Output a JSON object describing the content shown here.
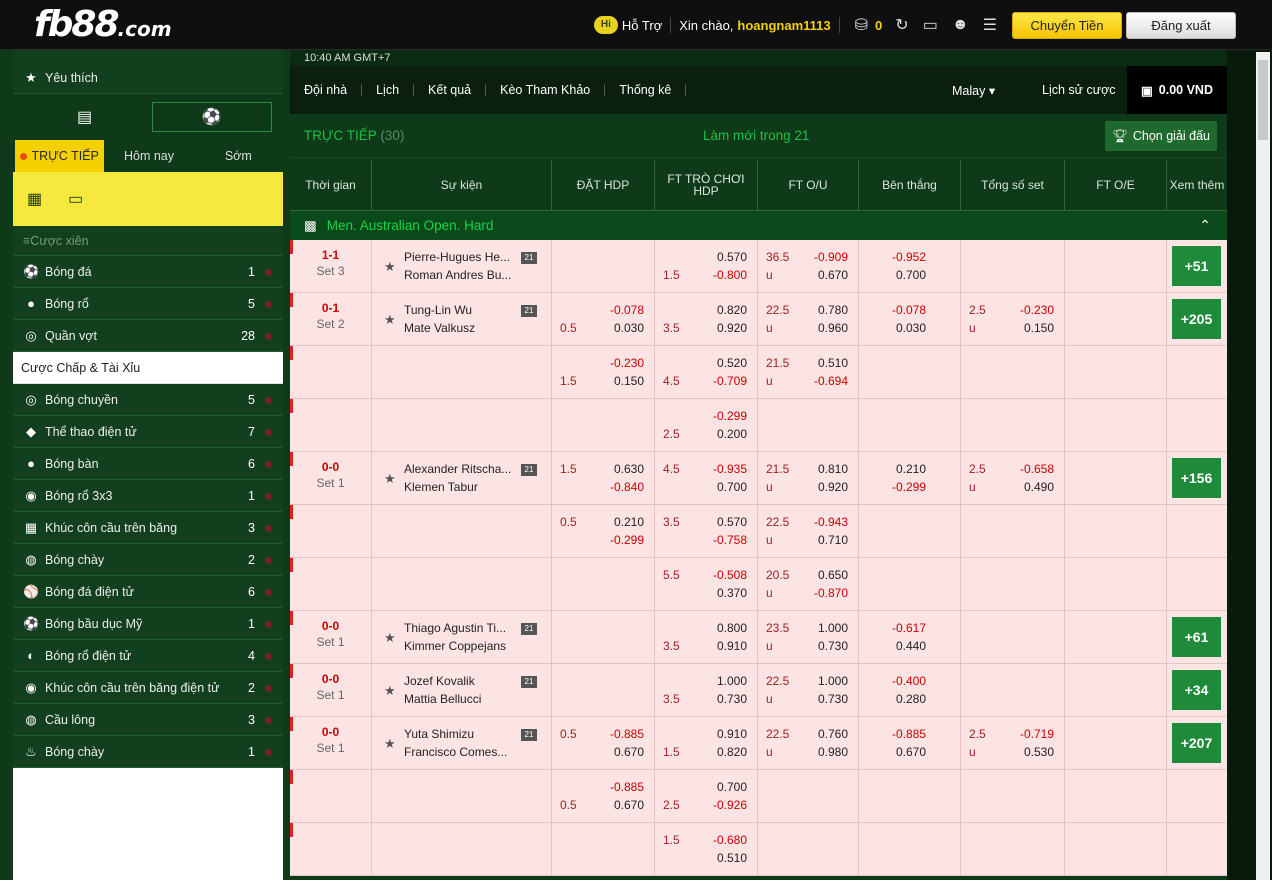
{
  "header": {
    "logo_main": "fb88",
    "logo_suffix": ".com",
    "hi": "Hi",
    "support": "Hỗ Trợ",
    "greeting": "Xin chào,",
    "username": "hoangnam1113",
    "balance_count": "0",
    "deposit": "Chuyển Tiền",
    "logout": "Đăng xuất"
  },
  "sidebar": {
    "favorites": "Yêu thích",
    "status_tabs": [
      "TRỰC TIẾP",
      "Hôm nay",
      "Sớm"
    ],
    "parlay": "Cược xiên",
    "sports": [
      {
        "name": "Bóng đá",
        "count": "1"
      },
      {
        "name": "Bóng rổ",
        "count": "5"
      },
      {
        "name": "Quần vợt",
        "count": "28"
      }
    ],
    "selected_market": "Cược Chấp & Tài Xỉu",
    "sports2": [
      {
        "name": "Bóng chuyền",
        "count": "5"
      },
      {
        "name": "Thể thao điện tử",
        "count": "7"
      },
      {
        "name": "Bóng bàn",
        "count": "6"
      },
      {
        "name": "Bóng rổ 3x3",
        "count": "1"
      },
      {
        "name": "Khúc côn cầu trên băng",
        "count": "3"
      },
      {
        "name": "Bóng chày",
        "count": "2"
      },
      {
        "name": "Bóng đá điện tử",
        "count": "6"
      },
      {
        "name": "Bóng bầu dục Mỹ",
        "count": "1"
      },
      {
        "name": "Bóng rổ điện tử",
        "count": "4"
      },
      {
        "name": "Khúc côn cầu trên băng điện tử",
        "count": "2"
      },
      {
        "name": "Cầu lông",
        "count": "3"
      },
      {
        "name": "Bóng chày",
        "count": "1"
      }
    ]
  },
  "main": {
    "clock": "10:40 AM GMT+7",
    "nav": [
      "Đội nhà",
      "Lịch",
      "Kết quả",
      "Kèo Tham Khảo",
      "Thống kê"
    ],
    "odds_type": "Malay",
    "history": "Lịch sử cược",
    "wallet": "0.00 VND",
    "live_label": "TRỰC TIẾP",
    "live_count": "(30)",
    "refresh": "Làm mới trong 21",
    "pick_league": "Chọn giải đấu",
    "columns": [
      "Thời gian",
      "Sự kiện",
      "ĐẶT HDP",
      "FT TRÒ CHƠI HDP",
      "FT O/U",
      "Bên thắng",
      "Tổng số set",
      "FT O/E",
      "Xem thêm"
    ],
    "league": "Men. Australian Open. Hard",
    "rows": [
      {
        "score": "1-1",
        "set": "Set 3",
        "t1": "Pierre-Hugues He...",
        "t2": "Roman Andres Bu...",
        "h": [
          "",
          "",
          "",
          "",
          ""
        ],
        "g": [
          "",
          "0.570",
          "1.5",
          "-0.800"
        ],
        "ou": [
          "36.5",
          "-0.909",
          "u",
          "0.670"
        ],
        "w": [
          "-0.952",
          "0.700"
        ],
        "s": [
          "",
          "",
          "",
          ""
        ],
        "more": "+51"
      },
      {
        "score": "0-1",
        "set": "Set 2",
        "t1": "Tung-Lin Wu",
        "t2": "Mate Valkusz",
        "h": [
          "",
          "-0.078",
          "0.5",
          "0.030"
        ],
        "g": [
          "",
          "0.820",
          "3.5",
          "0.920"
        ],
        "ou": [
          "22.5",
          "0.780",
          "u",
          "0.960"
        ],
        "w": [
          "-0.078",
          "0.030"
        ],
        "s": [
          "2.5",
          "-0.230",
          "u",
          "0.150"
        ],
        "more": "+205"
      },
      {
        "score": "",
        "set": "",
        "t1": "",
        "t2": "",
        "h": [
          "",
          "-0.230",
          "1.5",
          "0.150"
        ],
        "g": [
          "",
          "0.520",
          "4.5",
          "-0.709"
        ],
        "ou": [
          "21.5",
          "0.510",
          "u",
          "-0.694"
        ],
        "w": [
          "",
          ""
        ],
        "s": [
          "",
          "",
          "",
          ""
        ],
        "more": ""
      },
      {
        "score": "",
        "set": "",
        "t1": "",
        "t2": "",
        "h": [
          "",
          "",
          "",
          ""
        ],
        "g": [
          "",
          "-0.299",
          "2.5",
          "0.200"
        ],
        "ou": [
          "",
          "",
          "",
          ""
        ],
        "w": [
          "",
          ""
        ],
        "s": [
          "",
          "",
          "",
          ""
        ],
        "more": ""
      },
      {
        "score": "0-0",
        "set": "Set 1",
        "t1": "Alexander Ritscha...",
        "t2": "Klemen Tabur",
        "h": [
          "1.5",
          "0.630",
          "",
          "-0.840"
        ],
        "g": [
          "4.5",
          "-0.935",
          "",
          "0.700"
        ],
        "ou": [
          "21.5",
          "0.810",
          "u",
          "0.920"
        ],
        "w": [
          "0.210",
          "-0.299"
        ],
        "s": [
          "2.5",
          "-0.658",
          "u",
          "0.490"
        ],
        "more": "+156"
      },
      {
        "score": "",
        "set": "",
        "t1": "",
        "t2": "",
        "h": [
          "0.5",
          "0.210",
          "",
          "-0.299"
        ],
        "g": [
          "3.5",
          "0.570",
          "",
          "-0.758"
        ],
        "ou": [
          "22.5",
          "-0.943",
          "u",
          "0.710"
        ],
        "w": [
          "",
          ""
        ],
        "s": [
          "",
          "",
          "",
          ""
        ],
        "more": ""
      },
      {
        "score": "",
        "set": "",
        "t1": "",
        "t2": "",
        "h": [
          "",
          "",
          "",
          ""
        ],
        "g": [
          "5.5",
          "-0.508",
          "",
          "0.370"
        ],
        "ou": [
          "20.5",
          "0.650",
          "u",
          "-0.870"
        ],
        "w": [
          "",
          ""
        ],
        "s": [
          "",
          "",
          "",
          ""
        ],
        "more": ""
      },
      {
        "score": "0-0",
        "set": "Set 1",
        "t1": "Thiago Agustin Ti...",
        "t2": "Kimmer Coppejans",
        "h": [
          "",
          "",
          "",
          ""
        ],
        "g": [
          "",
          "0.800",
          "3.5",
          "0.910"
        ],
        "ou": [
          "23.5",
          "1.000",
          "u",
          "0.730"
        ],
        "w": [
          "-0.617",
          "0.440"
        ],
        "s": [
          "",
          "",
          "",
          ""
        ],
        "more": "+61"
      },
      {
        "score": "0-0",
        "set": "Set 1",
        "t1": "Jozef Kovalik",
        "t2": "Mattia Bellucci",
        "h": [
          "",
          "",
          "",
          ""
        ],
        "g": [
          "",
          "1.000",
          "3.5",
          "0.730"
        ],
        "ou": [
          "22.5",
          "1.000",
          "u",
          "0.730"
        ],
        "w": [
          "-0.400",
          "0.280"
        ],
        "s": [
          "",
          "",
          "",
          ""
        ],
        "more": "+34"
      },
      {
        "score": "0-0",
        "set": "Set 1",
        "t1": "Yuta Shimizu",
        "t2": "Francisco Comes...",
        "h": [
          "0.5",
          "-0.885",
          "",
          "0.670"
        ],
        "g": [
          "",
          "0.910",
          "1.5",
          "0.820"
        ],
        "ou": [
          "22.5",
          "0.760",
          "u",
          "0.980"
        ],
        "w": [
          "-0.885",
          "0.670"
        ],
        "s": [
          "2.5",
          "-0.719",
          "u",
          "0.530"
        ],
        "more": "+207"
      },
      {
        "score": "",
        "set": "",
        "t1": "",
        "t2": "",
        "h": [
          "",
          "-0.885",
          "0.5",
          "0.670"
        ],
        "g": [
          "",
          "0.700",
          "2.5",
          "-0.926"
        ],
        "ou": [
          "",
          "",
          "",
          ""
        ],
        "w": [
          "",
          ""
        ],
        "s": [
          "",
          "",
          "",
          ""
        ],
        "more": ""
      },
      {
        "score": "",
        "set": "",
        "t1": "",
        "t2": "",
        "h": [
          "",
          "",
          "",
          ""
        ],
        "g": [
          "1.5",
          "-0.680",
          "",
          "0.510"
        ],
        "ou": [
          "",
          "",
          "",
          ""
        ],
        "w": [
          "",
          ""
        ],
        "s": [
          "",
          "",
          "",
          ""
        ],
        "more": ""
      }
    ]
  }
}
